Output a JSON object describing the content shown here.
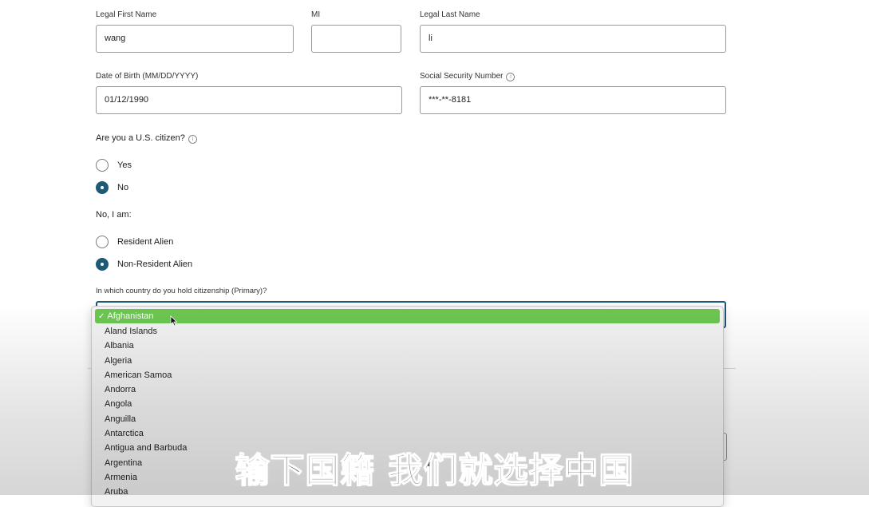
{
  "form": {
    "first_name": {
      "label": "Legal First Name",
      "value": "wang"
    },
    "middle_initial": {
      "label": "MI",
      "value": ""
    },
    "last_name": {
      "label": "Legal Last Name",
      "value": "li"
    },
    "dob": {
      "label": "Date of Birth (MM/DD/YYYY)",
      "value": "01/12/1990"
    },
    "ssn": {
      "label": "Social Security Number",
      "value": "***-**-8181",
      "info_icon": "info-icon"
    },
    "citizen_question": "Are you a U.S. citizen?",
    "citizen_options": [
      {
        "label": "Yes",
        "checked": false
      },
      {
        "label": "No",
        "checked": true
      }
    ],
    "alien_question": "No, I am:",
    "alien_options": [
      {
        "label": "Resident Alien",
        "checked": false
      },
      {
        "label": "Non-Resident Alien",
        "checked": true
      }
    ],
    "country_question": "In which country do you hold citizenship (Primary)?"
  },
  "country_dropdown": {
    "selected": "Afghanistan",
    "check_mark": "✓",
    "options": [
      "Afghanistan",
      "Aland Islands",
      "Albania",
      "Algeria",
      "American Samoa",
      "Andorra",
      "Angola",
      "Anguilla",
      "Antarctica",
      "Antigua and Barbuda",
      "Argentina",
      "Armenia",
      "Aruba"
    ]
  },
  "subtitle": "输下国籍 我们就选择中国",
  "colors": {
    "radio_checked": "#1d5a78",
    "option_highlight": "#6cc551"
  }
}
